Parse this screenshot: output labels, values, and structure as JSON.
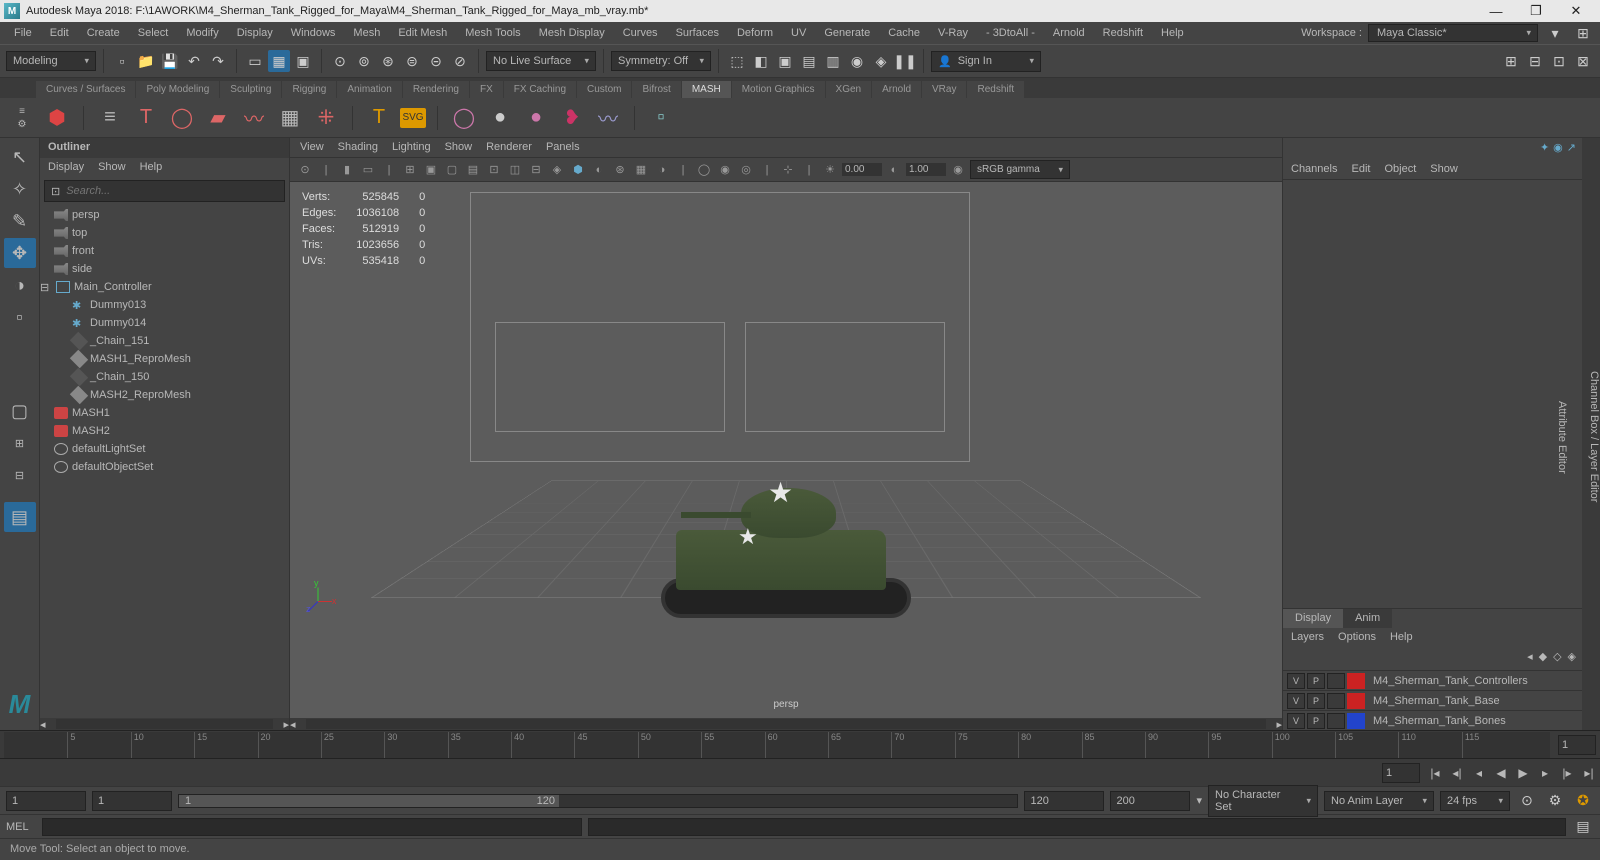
{
  "titlebar": {
    "title": "Autodesk Maya 2018: F:\\1AWORK\\M4_Sherman_Tank_Rigged_for_Maya\\M4_Sherman_Tank_Rigged_for_Maya_mb_vray.mb*"
  },
  "menubar": {
    "items": [
      "File",
      "Edit",
      "Create",
      "Select",
      "Modify",
      "Display",
      "Windows",
      "Mesh",
      "Edit Mesh",
      "Mesh Tools",
      "Mesh Display",
      "Curves",
      "Surfaces",
      "Deform",
      "UV",
      "Generate",
      "Cache",
      "V-Ray",
      "- 3DtoAll -",
      "Arnold",
      "Redshift",
      "Help"
    ],
    "workspace_label": "Workspace :",
    "workspace_value": "Maya Classic*"
  },
  "toolbar": {
    "mode": "Modeling",
    "live_surface": "No Live Surface",
    "symmetry": "Symmetry: Off",
    "signin": "Sign In"
  },
  "shelves": [
    "Curves / Surfaces",
    "Poly Modeling",
    "Sculpting",
    "Rigging",
    "Animation",
    "Rendering",
    "FX",
    "FX Caching",
    "Custom",
    "Bifrost",
    "MASH",
    "Motion Graphics",
    "XGen",
    "Arnold",
    "VRay",
    "Redshift"
  ],
  "active_shelf": "MASH",
  "outliner": {
    "title": "Outliner",
    "menu": [
      "Display",
      "Show",
      "Help"
    ],
    "search_placeholder": "Search...",
    "nodes": [
      {
        "label": "persp",
        "icon": "cam",
        "dim": true,
        "indent": 0
      },
      {
        "label": "top",
        "icon": "cam",
        "dim": true,
        "indent": 0
      },
      {
        "label": "front",
        "icon": "cam",
        "dim": true,
        "indent": 0
      },
      {
        "label": "side",
        "icon": "cam",
        "dim": true,
        "indent": 0
      },
      {
        "label": "Main_Controller",
        "icon": "loc",
        "dim": false,
        "indent": 0,
        "exp": true
      },
      {
        "label": "Dummy013",
        "icon": "star",
        "dim": false,
        "indent": 1
      },
      {
        "label": "Dummy014",
        "icon": "star",
        "dim": false,
        "indent": 1
      },
      {
        "label": "_Chain_151",
        "icon": "dia",
        "dim": true,
        "indent": 1
      },
      {
        "label": "MASH1_ReproMesh",
        "icon": "dia",
        "dim": false,
        "indent": 1
      },
      {
        "label": "_Chain_150",
        "icon": "dia",
        "dim": true,
        "indent": 1
      },
      {
        "label": "MASH2_ReproMesh",
        "icon": "dia",
        "dim": false,
        "indent": 1
      },
      {
        "label": "MASH1",
        "icon": "msh",
        "dim": false,
        "indent": 0
      },
      {
        "label": "MASH2",
        "icon": "msh",
        "dim": false,
        "indent": 0
      },
      {
        "label": "defaultLightSet",
        "icon": "set",
        "dim": false,
        "indent": 0
      },
      {
        "label": "defaultObjectSet",
        "icon": "set",
        "dim": false,
        "indent": 0
      }
    ]
  },
  "viewport": {
    "menu": [
      "View",
      "Shading",
      "Lighting",
      "Show",
      "Renderer",
      "Panels"
    ],
    "num1": "0.00",
    "num2": "1.00",
    "gamma": "sRGB gamma",
    "camera": "persp",
    "stats": [
      {
        "k": "Verts:",
        "a": "525845",
        "b": "0"
      },
      {
        "k": "Edges:",
        "a": "1036108",
        "b": "0"
      },
      {
        "k": "Faces:",
        "a": "512919",
        "b": "0"
      },
      {
        "k": "Tris:",
        "a": "1023656",
        "b": "0"
      },
      {
        "k": "UVs:",
        "a": "535418",
        "b": "0"
      }
    ],
    "axes": {
      "x": "x",
      "y": "y",
      "z": "z"
    }
  },
  "right": {
    "menu": [
      "Channels",
      "Edit",
      "Object",
      "Show"
    ],
    "tabs": [
      "Display",
      "Anim"
    ],
    "layer_menu": [
      "Layers",
      "Options",
      "Help"
    ],
    "layers": [
      {
        "v": "V",
        "p": "P",
        "color": "#cc2222",
        "name": "M4_Sherman_Tank_Controllers"
      },
      {
        "v": "V",
        "p": "P",
        "color": "#cc2222",
        "name": "M4_Sherman_Tank_Base"
      },
      {
        "v": "V",
        "p": "P",
        "color": "#2244cc",
        "name": "M4_Sherman_Tank_Bones"
      }
    ],
    "side_labels": [
      "Channel Box / Layer Editor",
      "Attribute Editor"
    ]
  },
  "timeline": {
    "start": "1",
    "end": "1",
    "range_start": "1",
    "range_in": "1",
    "range_slider_label": "1",
    "range_slider_end": "120",
    "range_out": "120",
    "range_end": "200",
    "ticks": [
      "5",
      "10",
      "15",
      "20",
      "25",
      "30",
      "35",
      "40",
      "45",
      "50",
      "55",
      "60",
      "65",
      "70",
      "75",
      "80",
      "85",
      "90",
      "95",
      "100",
      "105",
      "110",
      "115"
    ],
    "char": "No Character Set",
    "anim": "No Anim Layer",
    "fps": "24 fps"
  },
  "cmd": {
    "label": "MEL"
  },
  "status": {
    "text": "Move Tool: Select an object to move."
  }
}
